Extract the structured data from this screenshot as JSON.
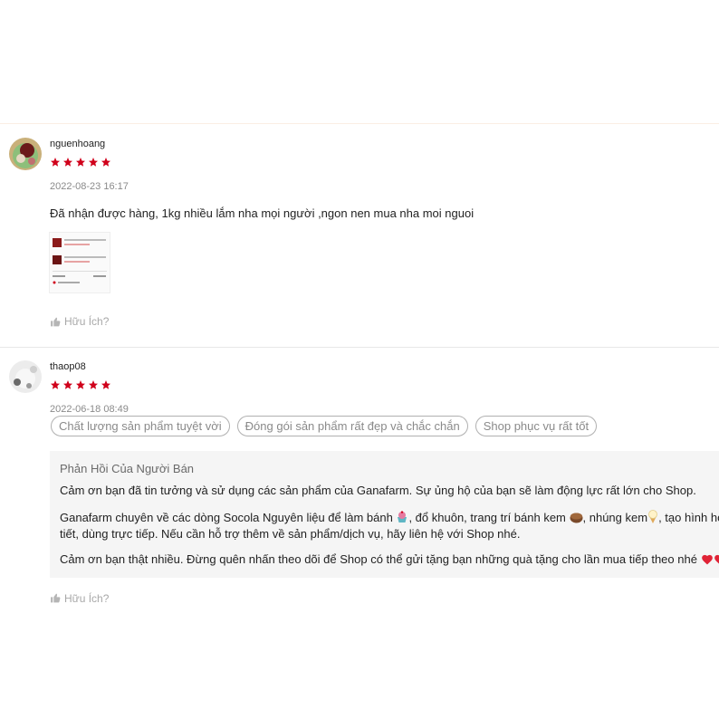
{
  "reviews": [
    {
      "username": "nguenhoang",
      "rating": 5,
      "timestamp": "2022-08-23 16:17",
      "content": "Đã nhận được hàng, 1kg nhiều lắm nha mọi người ,ngon nen mua nha moi nguoi",
      "helpful_label": "Hữu Ích?"
    },
    {
      "username": "thaop08",
      "rating": 5,
      "timestamp": "2022-06-18 08:49",
      "tags": [
        "Chất lượng sản phẩm tuyệt vời",
        "Đóng gói sản phẩm rất đẹp và chắc chắn",
        "Shop phục vụ rất tốt"
      ],
      "seller_reply": {
        "title": "Phản Hồi Của Người Bán",
        "p1": "Cảm ơn bạn đã tin tưởng và sử dụng các sản phẩm của Ganafarm. Sự ủng hộ của bạn sẽ làm động lực rất lớn cho Shop.",
        "p2_a": "Ganafarm chuyên về các dòng Socola Nguyên liệu để làm bánh ",
        "p2_b": ", đổ khuôn, trang trí bánh kem ",
        "p2_c": ", nhúng kem",
        "p2_d": ", tạo hình hoa",
        "p2_line2": "tiết, dùng trực tiếp. Nếu cần hỗ trợ thêm về sản phẩm/dịch vụ, hãy liên hệ với Shop nhé.",
        "p3": "Cảm ơn bạn thật nhiều. Đừng quên nhấn theo dõi để Shop có thể gửi tặng bạn những quà tặng cho lần mua tiếp theo nhé "
      },
      "helpful_label": "Hữu Ích?"
    }
  ],
  "colors": {
    "star": "#d0011b",
    "muted": "#8a8a8a",
    "reply_bg": "#f5f5f5"
  },
  "icons": [
    "star-icon",
    "thumbs-up-icon",
    "cupcake-emoji",
    "cake-emoji",
    "ice-cream-emoji",
    "heart-emoji"
  ]
}
